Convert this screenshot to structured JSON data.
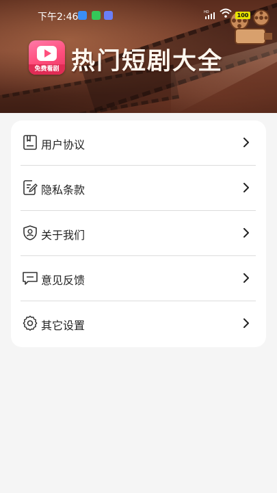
{
  "status_bar": {
    "time": "下午2:46",
    "battery": "100",
    "network": "HD"
  },
  "header": {
    "logo_tag": "免费看剧",
    "title": "热门短剧大全"
  },
  "menu": {
    "items": [
      {
        "label": "用户协议",
        "icon": "document-icon"
      },
      {
        "label": "隐私条款",
        "icon": "edit-document-icon"
      },
      {
        "label": "关于我们",
        "icon": "shield-user-icon"
      },
      {
        "label": "意见反馈",
        "icon": "message-icon"
      },
      {
        "label": "其它设置",
        "icon": "gear-icon"
      }
    ]
  },
  "colors": {
    "header_bg": "#6b3727",
    "page_bg": "#f5f5f5",
    "card_bg": "#ffffff",
    "text": "#222222",
    "logo_pink": "#ff4f7d"
  }
}
